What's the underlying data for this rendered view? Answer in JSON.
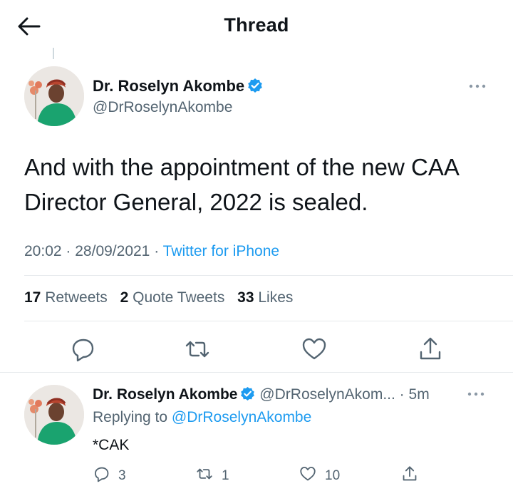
{
  "header": {
    "title": "Thread",
    "back_icon": "arrow-left-icon"
  },
  "tweet": {
    "author_name": "Dr. Roselyn Akombe",
    "handle": "@DrRoselynAkombe",
    "text": "And with the appointment of the new CAA Director General, 2022 is sealed.",
    "time": "20:02",
    "separator": "·",
    "date": "28/09/2021",
    "source": "Twitter for iPhone",
    "stats": {
      "retweets_count": "17",
      "retweets_label": "Retweets",
      "quotes_count": "2",
      "quotes_label": "Quote Tweets",
      "likes_count": "33",
      "likes_label": "Likes"
    },
    "actions": [
      "reply-icon",
      "retweet-icon",
      "like-icon",
      "share-icon"
    ]
  },
  "reply": {
    "author_name": "Dr. Roselyn Akombe",
    "handle": "@DrRoselynAkom...",
    "separator": "·",
    "time": "5m",
    "replying_prefix": "Replying to",
    "replying_to": "@DrRoselynAkombe",
    "text": "*CAK",
    "reply_count": "3",
    "retweet_count": "1",
    "like_count": "10"
  },
  "colors": {
    "accent": "#1d9bf0",
    "text": "#0f1419",
    "secondary": "#536471",
    "divider": "#e5e9ec"
  }
}
